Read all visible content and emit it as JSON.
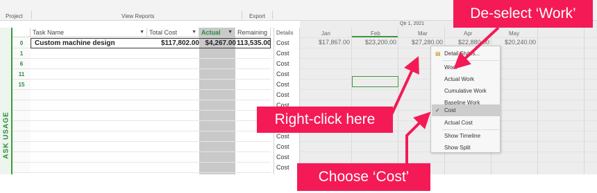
{
  "ribbon": {
    "project": "Project",
    "view_reports": "View Reports",
    "export": "Export"
  },
  "grid": {
    "side_tab": "ASK USAGE",
    "columns": {
      "task_name": "Task Name",
      "total_cost": "Total Cost",
      "actual": "Actual",
      "remaining": "Remaining"
    },
    "rows": [
      {
        "id": "0",
        "task_name": "Custom machine design",
        "total_cost": "$117,802.00",
        "actual": "$4,267.00",
        "remaining": "113,535.00"
      },
      {
        "id": "1"
      },
      {
        "id": "6"
      },
      {
        "id": "11"
      },
      {
        "id": "15"
      }
    ]
  },
  "timephased": {
    "details_header": "Details",
    "detail_label": "Cost",
    "quarter": "Qtr 1, 2021",
    "months": [
      "Jan",
      "Feb",
      "Mar",
      "Apr",
      "May"
    ],
    "values": [
      "$17,867.00",
      "$23,200.00",
      "$27,280.00",
      "$22,880.00",
      "$20,240.00"
    ]
  },
  "context_menu": {
    "items": [
      {
        "label": "Detail Styles...",
        "icon": "detail-styles-icon"
      },
      {
        "label": "Work"
      },
      {
        "label": "Actual Work"
      },
      {
        "label": "Cumulative Work"
      },
      {
        "label": "Baseline Work"
      },
      {
        "label": "Cost",
        "checked": true
      },
      {
        "label": "Actual Cost"
      },
      {
        "label": "Show Timeline"
      },
      {
        "label": "Show Split"
      }
    ]
  },
  "callouts": {
    "deselect": "De-select ‘Work’",
    "right_click": "Right-click here",
    "choose": "Choose ‘Cost’"
  },
  "colors": {
    "callout": "#f41a55",
    "row_number": "#2b8a3e",
    "actual_column": "#c9c9c9"
  }
}
